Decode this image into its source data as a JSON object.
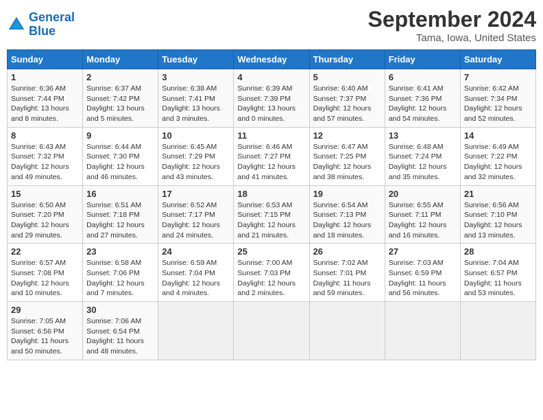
{
  "header": {
    "logo_line1": "General",
    "logo_line2": "Blue",
    "month": "September 2024",
    "location": "Tama, Iowa, United States"
  },
  "days_of_week": [
    "Sunday",
    "Monday",
    "Tuesday",
    "Wednesday",
    "Thursday",
    "Friday",
    "Saturday"
  ],
  "weeks": [
    [
      {
        "day": "1",
        "info": "Sunrise: 6:36 AM\nSunset: 7:44 PM\nDaylight: 13 hours\nand 8 minutes."
      },
      {
        "day": "2",
        "info": "Sunrise: 6:37 AM\nSunset: 7:42 PM\nDaylight: 13 hours\nand 5 minutes."
      },
      {
        "day": "3",
        "info": "Sunrise: 6:38 AM\nSunset: 7:41 PM\nDaylight: 13 hours\nand 3 minutes."
      },
      {
        "day": "4",
        "info": "Sunrise: 6:39 AM\nSunset: 7:39 PM\nDaylight: 13 hours\nand 0 minutes."
      },
      {
        "day": "5",
        "info": "Sunrise: 6:40 AM\nSunset: 7:37 PM\nDaylight: 12 hours\nand 57 minutes."
      },
      {
        "day": "6",
        "info": "Sunrise: 6:41 AM\nSunset: 7:36 PM\nDaylight: 12 hours\nand 54 minutes."
      },
      {
        "day": "7",
        "info": "Sunrise: 6:42 AM\nSunset: 7:34 PM\nDaylight: 12 hours\nand 52 minutes."
      }
    ],
    [
      {
        "day": "8",
        "info": "Sunrise: 6:43 AM\nSunset: 7:32 PM\nDaylight: 12 hours\nand 49 minutes."
      },
      {
        "day": "9",
        "info": "Sunrise: 6:44 AM\nSunset: 7:30 PM\nDaylight: 12 hours\nand 46 minutes."
      },
      {
        "day": "10",
        "info": "Sunrise: 6:45 AM\nSunset: 7:29 PM\nDaylight: 12 hours\nand 43 minutes."
      },
      {
        "day": "11",
        "info": "Sunrise: 6:46 AM\nSunset: 7:27 PM\nDaylight: 12 hours\nand 41 minutes."
      },
      {
        "day": "12",
        "info": "Sunrise: 6:47 AM\nSunset: 7:25 PM\nDaylight: 12 hours\nand 38 minutes."
      },
      {
        "day": "13",
        "info": "Sunrise: 6:48 AM\nSunset: 7:24 PM\nDaylight: 12 hours\nand 35 minutes."
      },
      {
        "day": "14",
        "info": "Sunrise: 6:49 AM\nSunset: 7:22 PM\nDaylight: 12 hours\nand 32 minutes."
      }
    ],
    [
      {
        "day": "15",
        "info": "Sunrise: 6:50 AM\nSunset: 7:20 PM\nDaylight: 12 hours\nand 29 minutes."
      },
      {
        "day": "16",
        "info": "Sunrise: 6:51 AM\nSunset: 7:18 PM\nDaylight: 12 hours\nand 27 minutes."
      },
      {
        "day": "17",
        "info": "Sunrise: 6:52 AM\nSunset: 7:17 PM\nDaylight: 12 hours\nand 24 minutes."
      },
      {
        "day": "18",
        "info": "Sunrise: 6:53 AM\nSunset: 7:15 PM\nDaylight: 12 hours\nand 21 minutes."
      },
      {
        "day": "19",
        "info": "Sunrise: 6:54 AM\nSunset: 7:13 PM\nDaylight: 12 hours\nand 18 minutes."
      },
      {
        "day": "20",
        "info": "Sunrise: 6:55 AM\nSunset: 7:11 PM\nDaylight: 12 hours\nand 16 minutes."
      },
      {
        "day": "21",
        "info": "Sunrise: 6:56 AM\nSunset: 7:10 PM\nDaylight: 12 hours\nand 13 minutes."
      }
    ],
    [
      {
        "day": "22",
        "info": "Sunrise: 6:57 AM\nSunset: 7:08 PM\nDaylight: 12 hours\nand 10 minutes."
      },
      {
        "day": "23",
        "info": "Sunrise: 6:58 AM\nSunset: 7:06 PM\nDaylight: 12 hours\nand 7 minutes."
      },
      {
        "day": "24",
        "info": "Sunrise: 6:59 AM\nSunset: 7:04 PM\nDaylight: 12 hours\nand 4 minutes."
      },
      {
        "day": "25",
        "info": "Sunrise: 7:00 AM\nSunset: 7:03 PM\nDaylight: 12 hours\nand 2 minutes."
      },
      {
        "day": "26",
        "info": "Sunrise: 7:02 AM\nSunset: 7:01 PM\nDaylight: 11 hours\nand 59 minutes."
      },
      {
        "day": "27",
        "info": "Sunrise: 7:03 AM\nSunset: 6:59 PM\nDaylight: 11 hours\nand 56 minutes."
      },
      {
        "day": "28",
        "info": "Sunrise: 7:04 AM\nSunset: 6:57 PM\nDaylight: 11 hours\nand 53 minutes."
      }
    ],
    [
      {
        "day": "29",
        "info": "Sunrise: 7:05 AM\nSunset: 6:56 PM\nDaylight: 11 hours\nand 50 minutes."
      },
      {
        "day": "30",
        "info": "Sunrise: 7:06 AM\nSunset: 6:54 PM\nDaylight: 11 hours\nand 48 minutes."
      },
      {
        "day": "",
        "info": ""
      },
      {
        "day": "",
        "info": ""
      },
      {
        "day": "",
        "info": ""
      },
      {
        "day": "",
        "info": ""
      },
      {
        "day": "",
        "info": ""
      }
    ]
  ]
}
